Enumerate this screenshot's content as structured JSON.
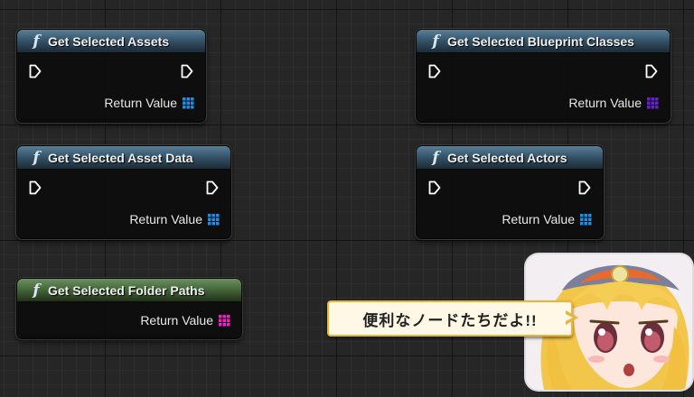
{
  "nodes": [
    {
      "title": "Get Selected Assets",
      "return_label": "Return Value",
      "pin_color": "#1b8fe8",
      "header": "impure"
    },
    {
      "title": "Get Selected Blueprint Classes",
      "return_label": "Return Value",
      "pin_color": "#6a1fd6",
      "header": "impure"
    },
    {
      "title": "Get Selected Asset Data",
      "return_label": "Return Value",
      "pin_color": "#1b8fe8",
      "header": "impure"
    },
    {
      "title": "Get Selected Actors",
      "return_label": "Return Value",
      "pin_color": "#1b8fe8",
      "header": "impure"
    },
    {
      "title": "Get Selected Folder Paths",
      "return_label": "Return Value",
      "pin_color": "#f020c8",
      "header": "pure"
    }
  ],
  "function_icon": "function-icon",
  "speech_bubble": {
    "text": "便利なノードたちだよ!!"
  },
  "avatar": {
    "icon": "anime-girl-avatar"
  }
}
